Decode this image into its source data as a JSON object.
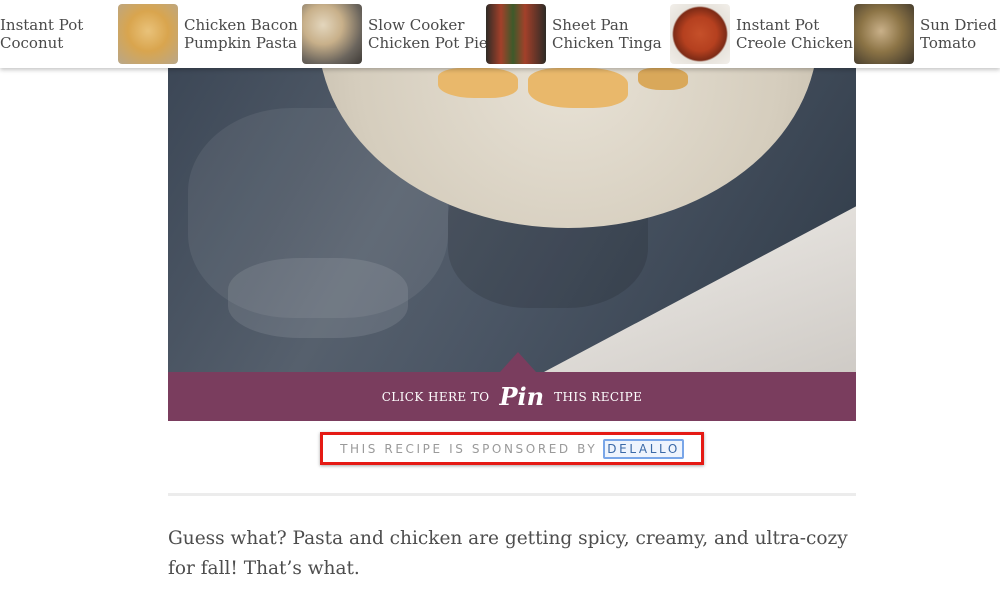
{
  "related_recipes": [
    {
      "title": "Instant Pot\nCoconut",
      "thumb_color": "#ffffff"
    },
    {
      "title": "Chicken Bacon\nPumpkin Pasta",
      "thumb_color": "#d9a54e"
    },
    {
      "title": "Slow Cooker\nChicken Pot Pie",
      "thumb_color": "#c8b08a"
    },
    {
      "title": "Sheet Pan\nChicken Tinga",
      "thumb_color": "#a3402a"
    },
    {
      "title": "Instant Pot\nCreole Chicken",
      "thumb_color": "#b5401f"
    },
    {
      "title": "Sun Dried\nTomato",
      "thumb_color": "#5c4a2c"
    }
  ],
  "pin_banner": {
    "prefix": "Click here to",
    "pin_word": "Pin",
    "suffix": "this recipe"
  },
  "sponsor": {
    "text": "This recipe is sponsored by",
    "link": "DeLallo"
  },
  "article": {
    "paragraph": "Guess what? Pasta and chicken are getting spicy, creamy, and ultra-cozy for fall! That’s what."
  },
  "colors": {
    "pin_banner_bg": "#7a3d5e",
    "highlight_border": "#e51a14",
    "link_color": "#3b6aa8"
  }
}
